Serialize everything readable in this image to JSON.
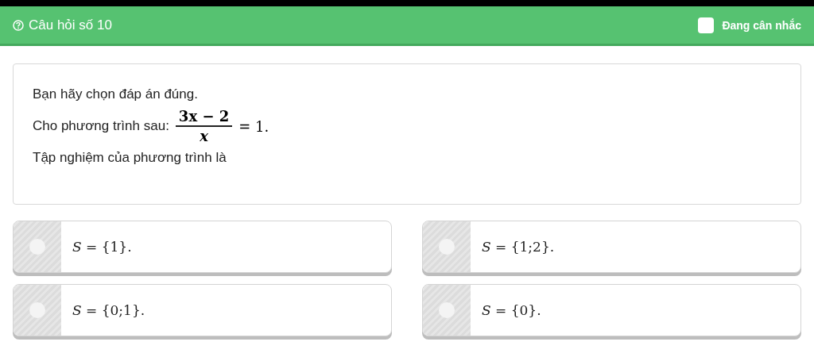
{
  "header": {
    "title": "Câu hỏi số 10",
    "considering": {
      "label": "Đang cân nhắc",
      "checked": false
    }
  },
  "question": {
    "instruction": "Bạn hãy chọn đáp án đúng.",
    "equation_intro": "Cho phương trình sau:",
    "numerator": "3x − 2",
    "denominator": "x",
    "equation_tail": "= 1.",
    "prompt": "Tập nghiệm của phương trình là"
  },
  "answers": [
    {
      "text": "*S* = {1}.",
      "selected": false
    },
    {
      "text": "*S* = {1;2}.",
      "selected": false
    },
    {
      "text": "*S* = {0;1}.",
      "selected": false
    },
    {
      "text": "*S* = {0}.",
      "selected": false
    }
  ]
}
